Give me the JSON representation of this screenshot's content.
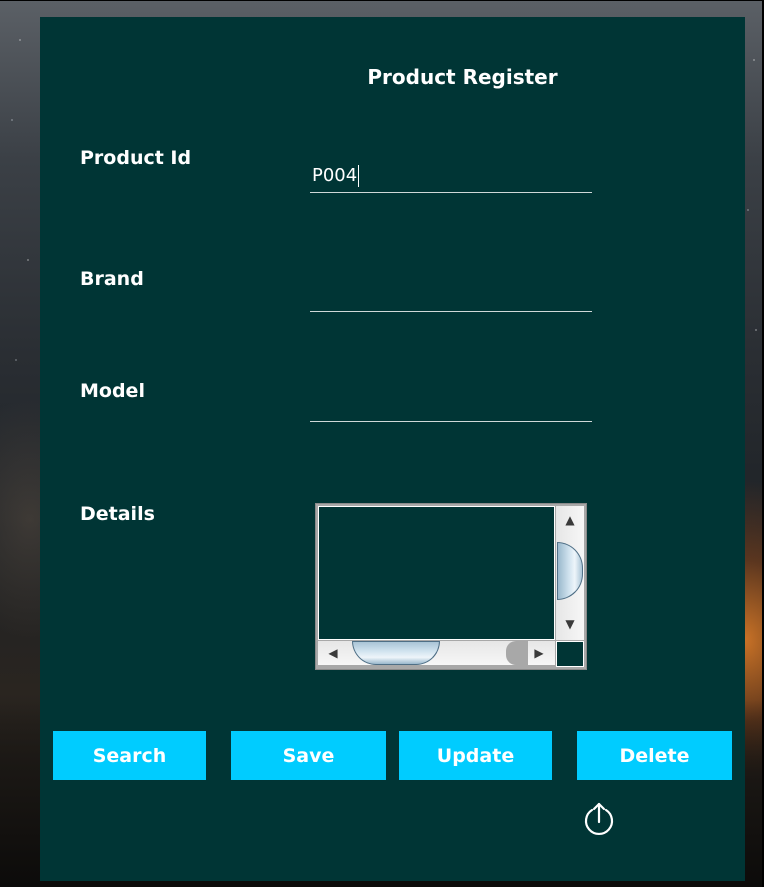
{
  "form": {
    "title": "Product Register",
    "fields": {
      "product_id": {
        "label": "Product Id",
        "value": "P004"
      },
      "brand": {
        "label": "Brand",
        "value": ""
      },
      "model": {
        "label": "Model",
        "value": ""
      },
      "details": {
        "label": "Details",
        "value": ""
      }
    },
    "scrollbar_icons": {
      "up": "▲",
      "down": "▼",
      "left": "◀",
      "right": "▶"
    },
    "buttons": {
      "search": "Search",
      "save": "Save",
      "update": "Update",
      "delete": "Delete"
    },
    "export_icon": "upload-circle-icon"
  },
  "colors": {
    "panel": "#003535",
    "button": "#00ccff",
    "text": "#ffffff"
  }
}
